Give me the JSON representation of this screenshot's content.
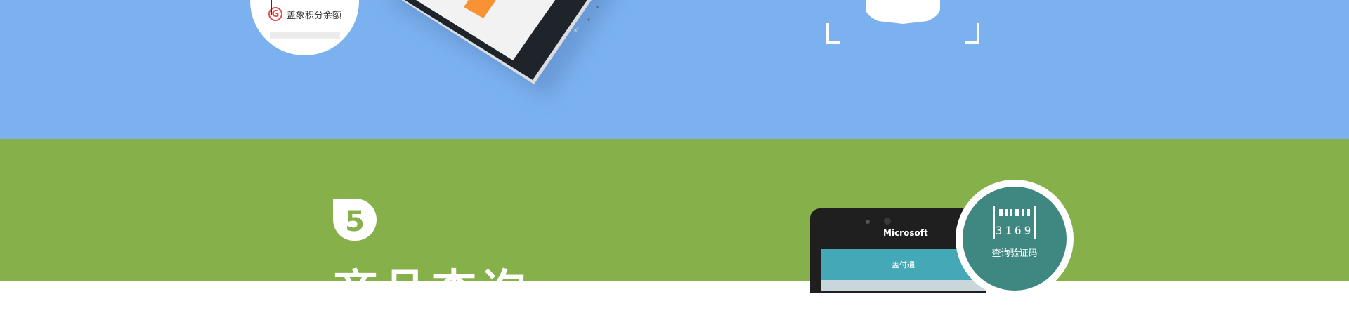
{
  "colors": {
    "top_background": "#7bb1ef",
    "bottom_background": "#85b04a",
    "accent_orange": "#f89233",
    "teal": "#3f8882",
    "app_bar": "#44a8b6"
  },
  "top_badge": {
    "label": "盖象积分余额",
    "icon": "g-circle-icon",
    "icon_letter": "G"
  },
  "section": {
    "number": "5",
    "title": "商品查询"
  },
  "phone": {
    "brand": "Microsoft",
    "app_bar_title": "盖付通"
  },
  "bottom_badge": {
    "barcode_digits": "3169",
    "label": "查询验证码",
    "icon": "barcode-icon"
  }
}
